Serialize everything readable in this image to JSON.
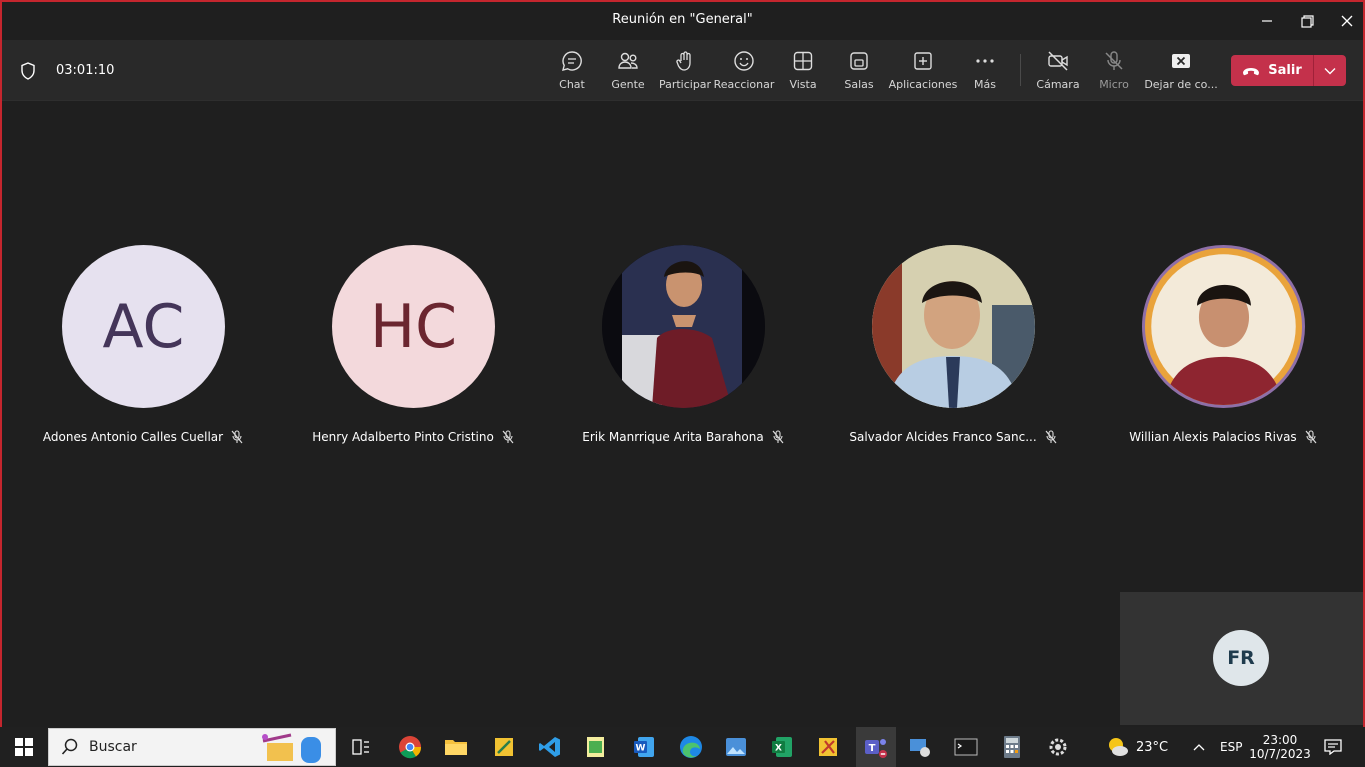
{
  "window": {
    "title": "Reunión en \"General\""
  },
  "toolbar": {
    "timer": "03:01:10",
    "buttons": [
      {
        "label": "Chat",
        "icon": "chat-icon"
      },
      {
        "label": "Gente",
        "icon": "people-icon"
      },
      {
        "label": "Participar",
        "icon": "raise-hand-icon"
      },
      {
        "label": "Reaccionar",
        "icon": "smiley-icon"
      },
      {
        "label": "Vista",
        "icon": "grid-view-icon"
      },
      {
        "label": "Salas",
        "icon": "breakout-rooms-icon"
      },
      {
        "label": "Aplicaciones",
        "icon": "add-app-icon"
      },
      {
        "label": "Más",
        "icon": "more-icon"
      },
      {
        "label": "Cámara",
        "icon": "camera-off-icon"
      },
      {
        "label": "Micro",
        "icon": "mic-off-icon"
      },
      {
        "label": "Dejar de co...",
        "icon": "stop-share-icon"
      }
    ],
    "leave_label": "Salir"
  },
  "participants": [
    {
      "name": "Adones Antonio Calles Cuellar",
      "initials": "AC",
      "avatar_bg": "#e6e1ef",
      "initials_color": "#443559",
      "muted": true
    },
    {
      "name": "Henry Adalberto Pinto Cristino",
      "initials": "HC",
      "avatar_bg": "#f3d9dc",
      "initials_color": "#6b2630",
      "muted": true
    },
    {
      "name": "Erik Manrrique Arita Barahona",
      "initials": "",
      "photo": true,
      "muted": true
    },
    {
      "name": "Salvador Alcides Franco Sanc...",
      "initials": "",
      "photo": true,
      "muted": true
    },
    {
      "name": "Willian Alexis Palacios Rivas",
      "initials": "",
      "photo": true,
      "ring": "#e9a33b",
      "muted": true
    }
  ],
  "self_view": {
    "initials": "FR"
  },
  "taskbar": {
    "search_placeholder": "Buscar",
    "weather": "23°C",
    "language": "ESP",
    "time": "23:00",
    "date": "10/7/2023"
  },
  "colors": {
    "accent_leave": "#c4314b",
    "frame": "#c4262e",
    "background": "#1f1f1f"
  }
}
